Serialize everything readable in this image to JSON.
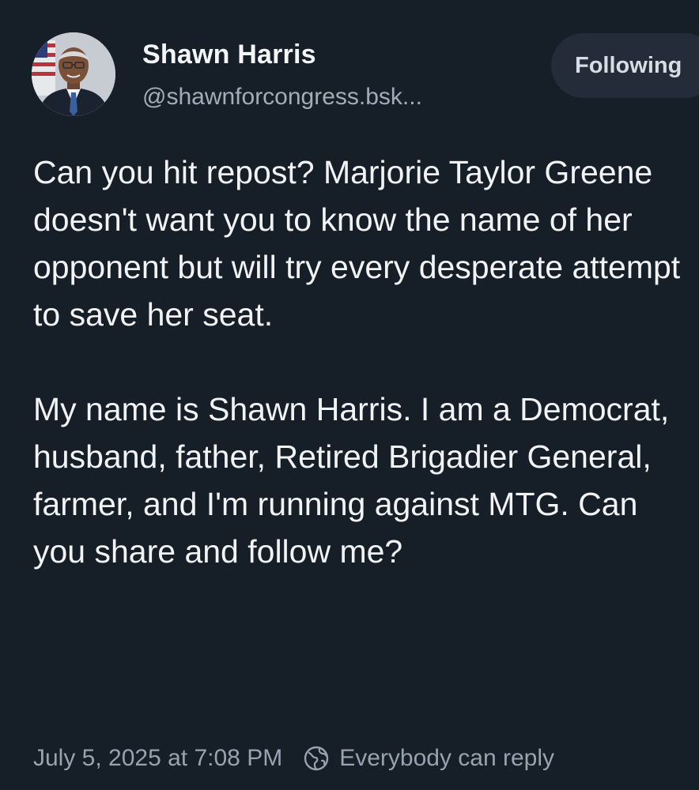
{
  "author": {
    "display_name": "Shawn Harris",
    "handle": "@shawnforcongress.bsk...",
    "avatar_icon": "profile-photo"
  },
  "follow_button": {
    "label": "Following"
  },
  "post": {
    "paragraphs": [
      "Can you hit repost? Marjorie Taylor Greene doesn't want you to know the name of her opponent but will try every desperate attempt to save her seat.",
      "My name is Shawn Harris. I am a Democrat, husband, father, Retired Brigadier General, farmer, and I'm running against MTG. Can you share and follow me?"
    ],
    "timestamp": "July 5, 2025 at 7:08 PM",
    "reply_setting": {
      "icon": "globe-icon",
      "label": "Everybody can reply"
    }
  },
  "colors": {
    "background": "#161e27",
    "text": "#f1f3f5",
    "muted": "#97a3b1",
    "button_bg": "#232c38"
  }
}
